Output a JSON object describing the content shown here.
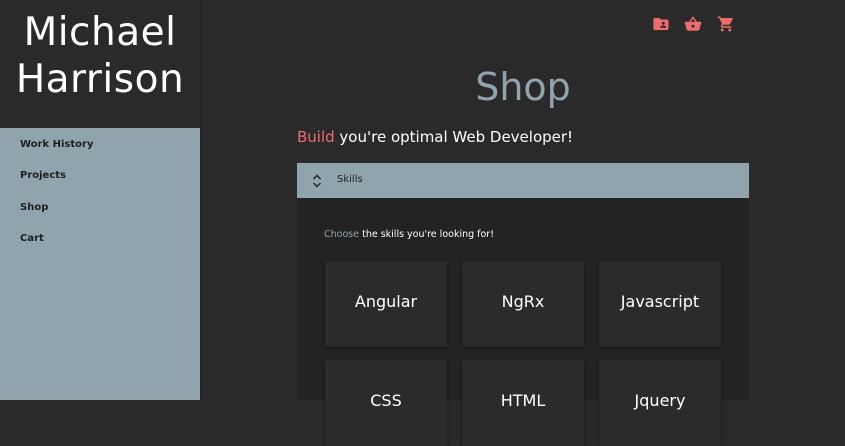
{
  "brand": {
    "first": "Michael",
    "last": "Harrison"
  },
  "nav": {
    "items": [
      {
        "label": "Work History"
      },
      {
        "label": "Projects"
      },
      {
        "label": "Shop"
      },
      {
        "label": "Cart"
      }
    ]
  },
  "topbar": {
    "icons": [
      "folder-shared-icon",
      "shopping-basket-icon",
      "shopping-cart-icon"
    ],
    "icon_color": "#ef6c6c"
  },
  "page": {
    "title": "Shop",
    "tagline_accent": "Build",
    "tagline_rest": " you're optimal Web Developer!"
  },
  "skills_panel": {
    "title": "Skills",
    "instruction_accent": "Choose",
    "instruction_rest": " the skills you're looking for!",
    "cards": [
      {
        "label": "Angular"
      },
      {
        "label": "NgRx"
      },
      {
        "label": "Javascript"
      },
      {
        "label": "CSS"
      },
      {
        "label": "HTML"
      },
      {
        "label": "Jquery"
      }
    ]
  },
  "colors": {
    "accent": "#ef6c6c",
    "primary": "#90a4ae",
    "background": "#2a2a2a"
  }
}
